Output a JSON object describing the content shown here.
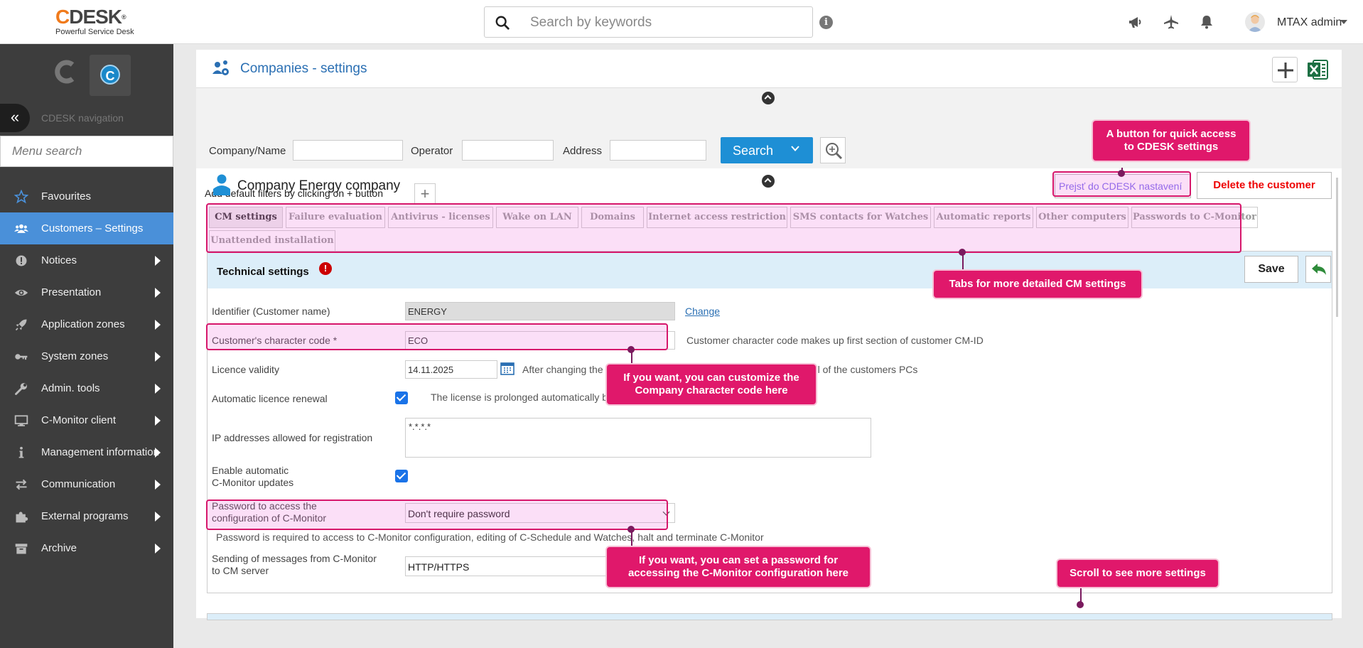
{
  "topbar": {
    "logo_letter": "C",
    "logo_rest": "DESK",
    "logo_reg": "®",
    "logo_tagline": "Powerful Service Desk",
    "search_placeholder": "Search by keywords",
    "info_glyph": "i",
    "user_name": "MTAX admin",
    "icons": [
      "megaphone-icon",
      "airplane-icon",
      "bell-icon",
      "user-avatar-icon"
    ]
  },
  "sidebar": {
    "nav_label": "CDESK navigation",
    "collapse_glyph": "«",
    "app_logo_letter": "C",
    "menu_search_placeholder": "Menu search",
    "items": [
      {
        "label": "Favourites",
        "icon": "star-icon",
        "active": false,
        "arrow": false
      },
      {
        "label": "Customers – Settings",
        "icon": "users-icon",
        "active": true,
        "arrow": false
      },
      {
        "label": "Notices",
        "icon": "alert-icon",
        "active": false,
        "arrow": true
      },
      {
        "label": "Presentation",
        "icon": "eye-icon",
        "active": false,
        "arrow": true
      },
      {
        "label": "Application zones",
        "icon": "rocket-icon",
        "active": false,
        "arrow": true
      },
      {
        "label": "System zones",
        "icon": "key-icon",
        "active": false,
        "arrow": true
      },
      {
        "label": "Admin. tools",
        "icon": "wrench-icon",
        "active": false,
        "arrow": true
      },
      {
        "label": "C-Monitor client",
        "icon": "monitor-icon",
        "active": false,
        "arrow": true
      },
      {
        "label": "Management information",
        "icon": "info-icon",
        "active": false,
        "arrow": true
      },
      {
        "label": "Communication",
        "icon": "exchange-icon",
        "active": false,
        "arrow": true
      },
      {
        "label": "External programs",
        "icon": "puzzle-icon",
        "active": false,
        "arrow": true
      },
      {
        "label": "Archive",
        "icon": "archive-icon",
        "active": false,
        "arrow": true
      }
    ]
  },
  "page": {
    "title": "Companies - settings",
    "filters": {
      "company_label": "Company/Name",
      "operator_label": "Operator",
      "address_label": "Address",
      "company_value": "",
      "operator_value": "",
      "address_value": "",
      "search_button": "Search",
      "add_default_text": "Add default filters by clicking on + button",
      "plus_glyph": "+"
    },
    "company_name": "Company Energy company",
    "cdesk_settings_button": "Prejsť do CDESK nastavení",
    "delete_button": "Delete the customer",
    "tabs": [
      "CM settings",
      "Failure evaluation",
      "Antivirus - licenses",
      "Wake on LAN",
      "Domains",
      "Internet access restriction",
      "SMS contacts for Watches",
      "Automatic reports",
      "Other computers",
      "Passwords to C-Monitor",
      "Unattended installation"
    ],
    "active_tab": "CM settings",
    "tech": {
      "title": "Technical settings",
      "warn_glyph": "!",
      "save_button": "Save",
      "identifier_label": "Identifier (Customer name)",
      "identifier_value": "ENERGY",
      "change_link": "Change",
      "char_code_label": "Customer's character code *",
      "char_code_value": "ECO",
      "char_code_note": "Customer character code makes up first section of customer CM-ID",
      "licence_label": "Licence validity",
      "licence_value": "14.11.2025",
      "licence_note": "After changing the date, the licences will be automatically sent to all of the customers PCs",
      "auto_renew_label": "Automatic licence renewal",
      "auto_renew_checked": true,
      "auto_renew_note": "The license is prolonged automatically before the expiration of the current license",
      "ip_label": "IP addresses allowed for registration",
      "ip_value": "*.*.*.*",
      "auto_update_label_1": "Enable automatic",
      "auto_update_label_2": "C-Monitor updates",
      "auto_update_checked": true,
      "password_label_1": "Password to access the",
      "password_label_2": "configuration of C-Monitor",
      "password_value": "Don't require password",
      "password_note": "Password is required to access to C-Monitor configuration, editing of C-Schedule and Watches, halt and terminate C-Monitor",
      "sending_label_1": "Sending of messages from C-Monitor",
      "sending_label_2": "to CM server",
      "sending_value": "HTTP/HTTPS"
    }
  },
  "annotations": {
    "cdesk_button_callout_1": "A button for quick access",
    "cdesk_button_callout_2": "to CDESK settings",
    "tabs_callout": "Tabs for more detailed CM settings",
    "char_code_callout_1": "If you want, you can customize the",
    "char_code_callout_2": "Company character code here",
    "password_callout_1": "If you want, you can set a password for",
    "password_callout_2": "accessing the C-Monitor configuration here",
    "scroll_callout": "Scroll to see more settings"
  },
  "colors": {
    "accent_blue": "#1e8fd5",
    "active_menu": "#4a90d9",
    "sidebar_bg": "#3d3d3d",
    "highlight_pink": "#e0186b",
    "logo_orange": "#f07a1b",
    "delete_red": "#e00000",
    "excel_green": "#1d7044"
  }
}
